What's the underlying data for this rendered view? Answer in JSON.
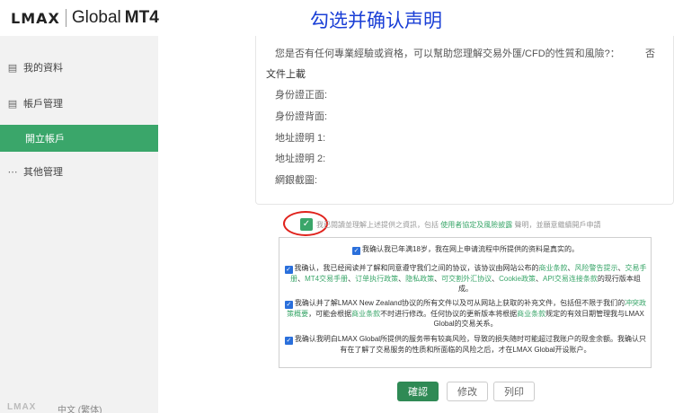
{
  "header": {
    "logo_lmax": "LMAX",
    "logo_global": "Global",
    "logo_mt4": "MT4",
    "annotation_title": "勾选并确认声明"
  },
  "sidebar": {
    "items": [
      {
        "label": "我的資料",
        "icon": "document-icon"
      },
      {
        "label": "帳戶管理",
        "icon": "list-icon"
      },
      {
        "label": "開立帳戶",
        "icon": ""
      },
      {
        "label": "其他管理",
        "icon": "more-icon"
      }
    ],
    "bottom_logo": "LMAX",
    "language": "中文 (繁体)"
  },
  "panel": {
    "question": "您是否有任何專業經驗或資格，可以幫助您理解交易外匯/CFD的性質和風險?：",
    "answer": "否",
    "upload_title": "文件上載",
    "uploads": [
      "身份證正面:",
      "身份證背面:",
      "地址證明 1:",
      "地址證明 2:",
      "網銀截圖:"
    ]
  },
  "master": {
    "text_a": "我已閱讀並理解上述提供之資訊，包括",
    "link": "使用者協定及風險披露",
    "text_b": "聲明，並願意繼續開戶申請"
  },
  "declarations": {
    "d1": "我确认我已年满18岁，我在网上申请流程中所提供的资料是真实的。",
    "d2_a": "我确认，我已经阅读并了解和同意遵守我们之间的协议，该协议由网站公布的",
    "d2_l1": "商业条款",
    "d2_s1": "、",
    "d2_l2": "风险警告提示",
    "d2_l3": "交易手册",
    "d2_l4": "MT4交易手册",
    "d2_l5": "订单执行政策",
    "d2_l6": "隐私政策",
    "d2_l7": "可交割外汇协议",
    "d2_l8": "Cookie政策",
    "d2_l9": "API交易连接条款",
    "d2_b": "的现行版本组成。",
    "d3_a": "我确认并了解LMAX New Zealand协议的所有文件以及可从网站上获取的补充文件，包括但不限于我们的",
    "d3_l1": "冲突政策概要",
    "d3_b": "，可能会根据",
    "d3_l2": "商业条款",
    "d3_c": "不时进行修改。任何协议的更新版本将根据",
    "d3_l3": "商业条款",
    "d3_d": "规定的有效日期管理我与LMAX Global的交易关系。",
    "d4": "我确认我明白LMAX Global所提供的服务带有较高风险，导致的损失随时可能超过我账户的现金余额。我确认只有在了解了交易服务的性质和所面临的风险之后，才在LMAX Global开设账户。"
  },
  "buttons": {
    "confirm": "確認",
    "edit": "修改",
    "print": "列印"
  }
}
